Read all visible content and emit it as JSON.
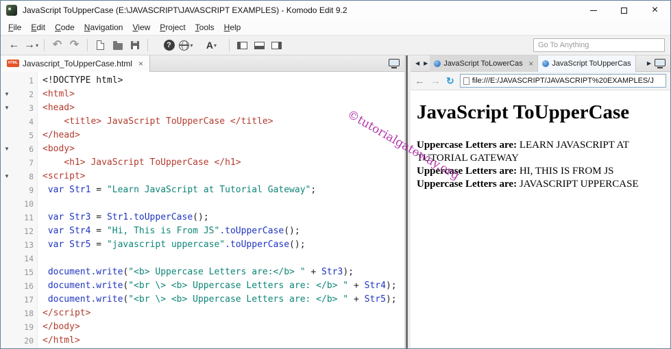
{
  "window": {
    "title": "JavaScript ToUpperCase (E:\\JAVASCRIPT\\JAVASCRIPT EXAMPLES) - Komodo Edit 9.2"
  },
  "menu": {
    "items": [
      "File",
      "Edit",
      "Code",
      "Navigation",
      "View",
      "Project",
      "Tools",
      "Help"
    ]
  },
  "toolbar": {
    "goto_placeholder": "Go To Anything",
    "font_button_label": "A"
  },
  "icons": {
    "back": "←",
    "forward": "→",
    "undo": "↶",
    "redo": "↷",
    "caret": "▾",
    "help": "?",
    "refresh": "↻",
    "tab_left": "◀",
    "tab_right": "▶",
    "close": "×",
    "fold": "▼"
  },
  "editor": {
    "tab_label": "Javascript_ToUpperCase.html",
    "tab_icon_label": "HTML",
    "lines": [
      {
        "n": 1,
        "fold": false,
        "segs": [
          {
            "c": "d",
            "t": "<!DOCTYPE html>"
          }
        ]
      },
      {
        "n": 2,
        "fold": true,
        "segs": [
          {
            "c": "t",
            "t": "<html>"
          }
        ]
      },
      {
        "n": 3,
        "fold": true,
        "segs": [
          {
            "c": "t",
            "t": "<head>"
          }
        ]
      },
      {
        "n": 4,
        "fold": false,
        "segs": [
          {
            "c": "t",
            "t": "    <title> JavaScript ToUpperCase </title>"
          }
        ]
      },
      {
        "n": 5,
        "fold": false,
        "segs": [
          {
            "c": "t",
            "t": "</head>"
          }
        ]
      },
      {
        "n": 6,
        "fold": true,
        "segs": [
          {
            "c": "t",
            "t": "<body>"
          }
        ]
      },
      {
        "n": 7,
        "fold": false,
        "segs": [
          {
            "c": "t",
            "t": "    <h1> JavaScript ToUpperCase </h1>"
          }
        ]
      },
      {
        "n": 8,
        "fold": true,
        "segs": [
          {
            "c": "t",
            "t": "<script>"
          }
        ]
      },
      {
        "n": 9,
        "fold": false,
        "segs": [
          {
            "c": "j",
            "t": " var Str1"
          },
          {
            "c": "o",
            "t": " = "
          },
          {
            "c": "s",
            "t": "\"Learn JavaScript at Tutorial Gateway\""
          },
          {
            "c": "o",
            "t": ";"
          }
        ]
      },
      {
        "n": 10,
        "fold": false,
        "segs": []
      },
      {
        "n": 11,
        "fold": false,
        "segs": [
          {
            "c": "j",
            "t": " var Str3"
          },
          {
            "c": "o",
            "t": " = "
          },
          {
            "c": "j",
            "t": "Str1.toUpperCase"
          },
          {
            "c": "o",
            "t": "();"
          }
        ]
      },
      {
        "n": 12,
        "fold": false,
        "segs": [
          {
            "c": "j",
            "t": " var Str4"
          },
          {
            "c": "o",
            "t": " = "
          },
          {
            "c": "s",
            "t": "\"Hi, This is From JS\""
          },
          {
            "c": "j",
            "t": ".toUpperCase"
          },
          {
            "c": "o",
            "t": "();"
          }
        ]
      },
      {
        "n": 13,
        "fold": false,
        "segs": [
          {
            "c": "j",
            "t": " var Str5"
          },
          {
            "c": "o",
            "t": " = "
          },
          {
            "c": "s",
            "t": "\"javascript uppercase\""
          },
          {
            "c": "j",
            "t": ".toUpperCase"
          },
          {
            "c": "o",
            "t": "();"
          }
        ]
      },
      {
        "n": 14,
        "fold": false,
        "segs": []
      },
      {
        "n": 15,
        "fold": false,
        "segs": [
          {
            "c": "j",
            "t": " document.write"
          },
          {
            "c": "o",
            "t": "("
          },
          {
            "c": "s",
            "t": "\"<b> Uppercase Letters are:</b> \""
          },
          {
            "c": "o",
            "t": " + "
          },
          {
            "c": "j",
            "t": "Str3"
          },
          {
            "c": "o",
            "t": ");"
          }
        ]
      },
      {
        "n": 16,
        "fold": false,
        "segs": [
          {
            "c": "j",
            "t": " document.write"
          },
          {
            "c": "o",
            "t": "("
          },
          {
            "c": "s",
            "t": "\"<br \\> <b> Uppercase Letters are: </b> \""
          },
          {
            "c": "o",
            "t": " + "
          },
          {
            "c": "j",
            "t": "Str4"
          },
          {
            "c": "o",
            "t": ");"
          }
        ]
      },
      {
        "n": 17,
        "fold": false,
        "segs": [
          {
            "c": "j",
            "t": " document.write"
          },
          {
            "c": "o",
            "t": "("
          },
          {
            "c": "s",
            "t": "\"<br \\> <b> Uppercase Letters are: </b> \""
          },
          {
            "c": "o",
            "t": " + "
          },
          {
            "c": "j",
            "t": "Str5"
          },
          {
            "c": "o",
            "t": ");"
          }
        ]
      },
      {
        "n": 18,
        "fold": false,
        "segs": [
          {
            "c": "t",
            "t": "</script>"
          }
        ]
      },
      {
        "n": 19,
        "fold": false,
        "segs": [
          {
            "c": "t",
            "t": "</body>"
          }
        ]
      },
      {
        "n": 20,
        "fold": false,
        "segs": [
          {
            "c": "t",
            "t": "</html>"
          }
        ]
      }
    ]
  },
  "preview": {
    "tabs": [
      {
        "label": "JavaScript ToLowerCase"
      },
      {
        "label": "JavaScript ToUpperCas"
      }
    ],
    "address": "file:///E:/JAVASCRIPT/JAVASCRIPT%20EXAMPLES/J",
    "heading": "JavaScript ToUpperCase",
    "watermark": "©tutorialgateway.org",
    "output": [
      {
        "label": "Uppercase Letters are:",
        "value": " LEARN JAVASCRIPT AT TUTORIAL GATEWAY"
      },
      {
        "label": "Uppercase Letters are:",
        "value": " HI, THIS IS FROM JS"
      },
      {
        "label": "Uppercase Letters are:",
        "value": " JAVASCRIPT UPPERCASE"
      }
    ]
  },
  "colors": {
    "tag_red": "#b23b2e",
    "js_blue": "#1f35c0",
    "string_teal": "#0e8577",
    "watermark_purple": "#a81b9f",
    "html_badge_orange": "#e5532a"
  }
}
